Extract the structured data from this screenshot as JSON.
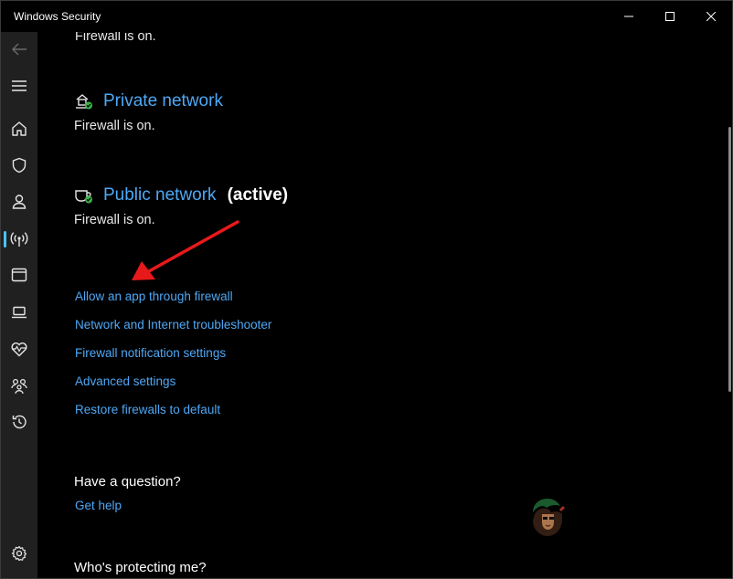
{
  "window": {
    "title": "Windows Security"
  },
  "sidebar": {
    "items": [
      {
        "icon": "back-arrow-icon"
      },
      {
        "icon": "menu-icon"
      },
      {
        "icon": "home-icon"
      },
      {
        "icon": "shield-icon"
      },
      {
        "icon": "person-icon"
      },
      {
        "icon": "wifi-signal-icon",
        "active": true
      },
      {
        "icon": "browser-window-icon"
      },
      {
        "icon": "laptop-icon"
      },
      {
        "icon": "heart-pulse-icon"
      },
      {
        "icon": "family-icon"
      },
      {
        "icon": "history-icon"
      },
      {
        "icon": "gear-icon"
      }
    ]
  },
  "content": {
    "domain_status": "Firewall is on.",
    "private_network": {
      "title": "Private network",
      "status": "Firewall is on."
    },
    "public_network": {
      "title": "Public network",
      "active_label": "(active)",
      "status": "Firewall is on."
    },
    "links": [
      "Allow an app through firewall",
      "Network and Internet troubleshooter",
      "Firewall notification settings",
      "Advanced settings",
      "Restore firewalls to default"
    ],
    "question": {
      "heading": "Have a question?",
      "link": "Get help"
    },
    "protecting": {
      "heading": "Who's protecting me?"
    }
  },
  "colors": {
    "link": "#4ea8f5",
    "sidebar_bg": "#202020",
    "accent": "#4cc2ff",
    "status_ok": "#3bb54a",
    "annotation_arrow": "#e8191b"
  }
}
